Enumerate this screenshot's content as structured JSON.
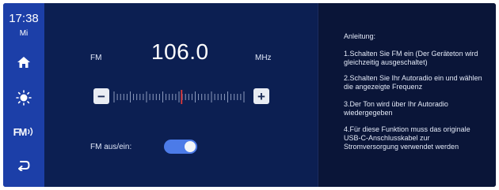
{
  "status": {
    "time": "17:38",
    "day": "Mi"
  },
  "nav": {
    "home_icon": "home-icon",
    "brightness_icon": "brightness-icon",
    "fm_label": "FM",
    "fm_icon": "radio-waves-icon",
    "back_icon": "back-arrow-icon"
  },
  "radio": {
    "band_label": "FM",
    "frequency": "106.0",
    "unit": "MHz",
    "minus_label": "−",
    "plus_label": "+",
    "tuner_position": 0.52,
    "toggle_label": "FM aus/ein:",
    "fm_enabled": true
  },
  "instructions": {
    "title": "Anleitung:",
    "steps": [
      "1.Schalten Sie FM ein (Der Geräteton wird gleichzeitig ausgeschaltet)",
      "2.Schalten Sie Ihr Autoradio ein und wählen die angezeigte Frequenz",
      "3.Der Ton wird über Ihr Autoradio wiedergegeben",
      "4.Für diese Funktion muss das originale USB-C-Anschlusskabel zur Stromversorgung verwendet werden"
    ]
  },
  "colors": {
    "sidebar": "#1c3fa8",
    "background": "#0b1a42",
    "accent": "#4c7be8",
    "tuner_marker": "#e23a3a"
  }
}
